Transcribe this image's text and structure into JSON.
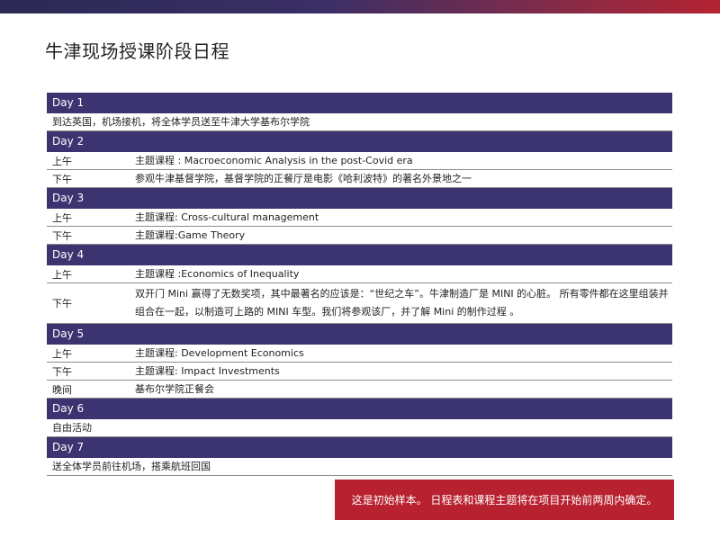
{
  "title": "牛津现场授课阶段日程",
  "notice": "这是初始样本。 日程表和课程主题将在项目开始前两周内确定。",
  "days": [
    {
      "label": "Day 1",
      "entries": [
        {
          "period": "",
          "activity": "到达英国，机场接机，将全体学员送至牛津大学基布尔学院"
        }
      ]
    },
    {
      "label": "Day 2",
      "entries": [
        {
          "period": "上午",
          "activity": "主题课程 : Macroeconomic Analysis in the post-Covid era"
        },
        {
          "period": "下午",
          "activity": "参观牛津基督学院，基督学院的正餐厅是电影《哈利波特》的著名外景地之一"
        }
      ]
    },
    {
      "label": "Day 3",
      "entries": [
        {
          "period": "上午",
          "activity": "主题课程: Cross-cultural management"
        },
        {
          "period": "下午",
          "activity": "主题课程:Game Theory"
        }
      ]
    },
    {
      "label": "Day 4",
      "entries": [
        {
          "period": "上午",
          "activity": "主题课程 :Economics of Inequality"
        },
        {
          "period": "下午",
          "activity": "双开门 Mini 赢得了无数奖项，其中最著名的应该是：“世纪之车”。牛津制造厂是 MINI 的心脏。 所有零件都在这里组装并组合在一起，以制造可上路的 MINI 车型。我们将参观该厂，并了解 Mini 的制作过程 。"
        }
      ]
    },
    {
      "label": "Day 5",
      "entries": [
        {
          "period": "上午",
          "activity": "主题课程: Development Economics"
        },
        {
          "period": "下午",
          "activity": "主题课程: Impact Investments"
        },
        {
          "period": "晚间",
          "activity": "基布尔学院正餐会"
        }
      ]
    },
    {
      "label": "Day 6",
      "entries": [
        {
          "period": "",
          "activity": "自由活动"
        }
      ]
    },
    {
      "label": "Day 7",
      "entries": [
        {
          "period": "",
          "activity": "送全体学员前往机场，搭乘航班回国"
        }
      ]
    }
  ]
}
